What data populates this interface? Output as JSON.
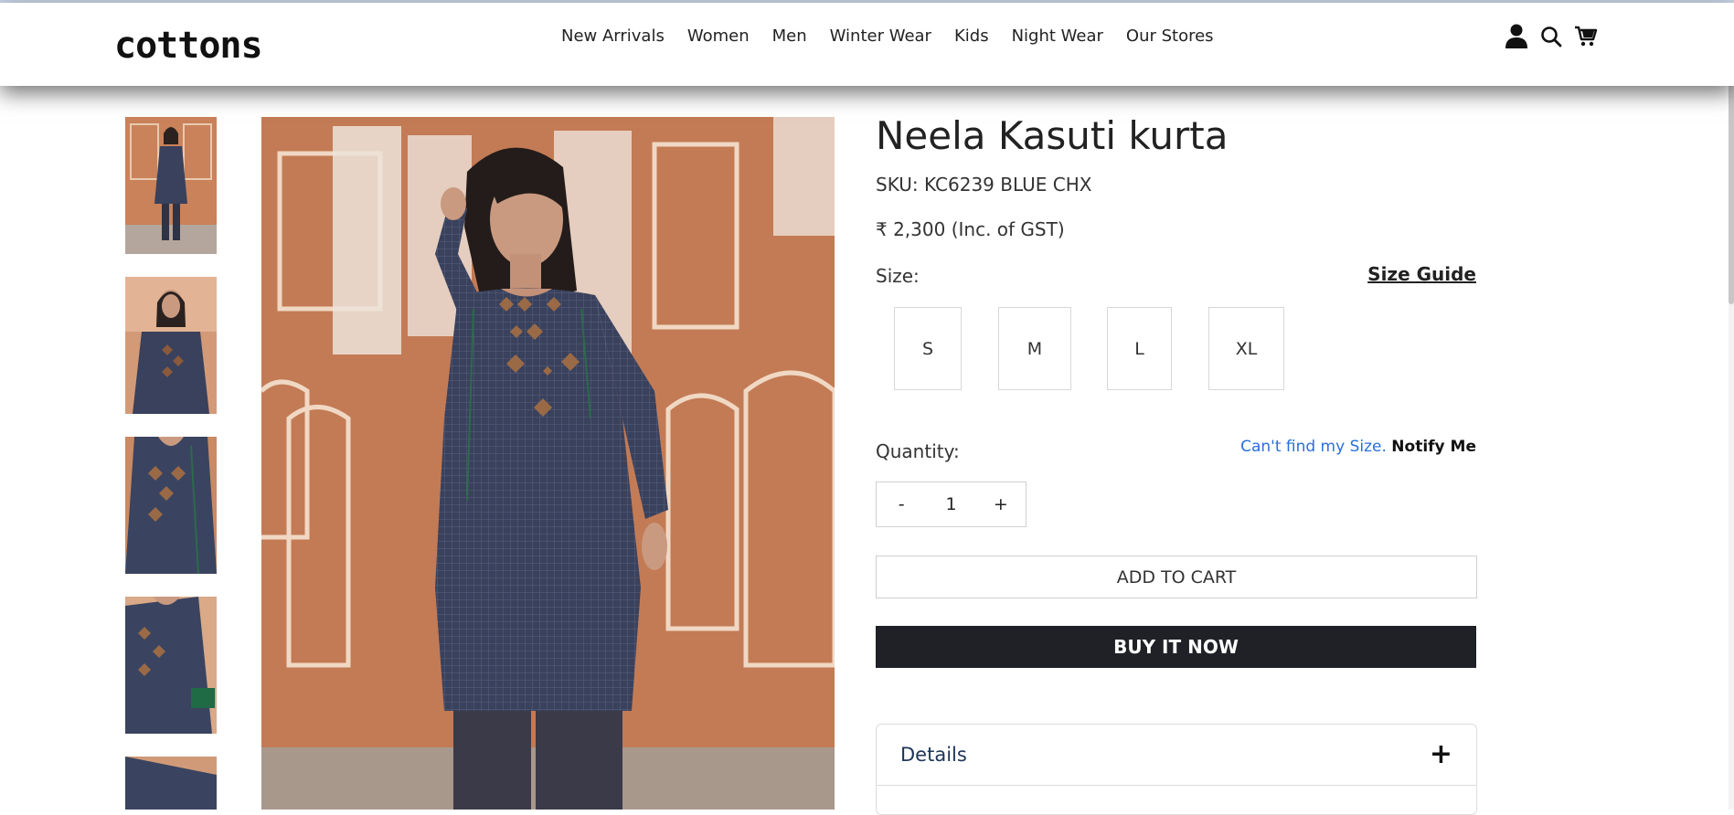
{
  "brand": {
    "logo": "cottons"
  },
  "nav": {
    "items": [
      "New Arrivals",
      "Women",
      "Men",
      "Winter Wear",
      "Kids",
      "Night Wear",
      "Our Stores"
    ]
  },
  "header_icons": [
    "user-icon",
    "search-icon",
    "cart-icon"
  ],
  "product": {
    "title": "Neela Kasuti kurta",
    "sku": "SKU: KC6239 BLUE CHX",
    "price": "₹ 2,300 (Inc. of GST)",
    "size_label": "Size:",
    "size_guide": "Size Guide",
    "sizes": [
      "S",
      "M",
      "L",
      "XL"
    ],
    "quantity_label": "Quantity:",
    "notify_prefix": "Can't find my Size.",
    "notify_link": "Notify Me",
    "quantity": {
      "minus": "-",
      "value": "1",
      "plus": "+"
    },
    "add_to_cart": "ADD TO CART",
    "buy_now": "BUY IT NOW",
    "details_label": "Details",
    "details_toggle": "+"
  },
  "colors": {
    "accent_dark": "#1f2126",
    "link_blue": "#2a6fdb",
    "wall_orange": "#c9825a",
    "kurta_navy": "#39415c"
  }
}
